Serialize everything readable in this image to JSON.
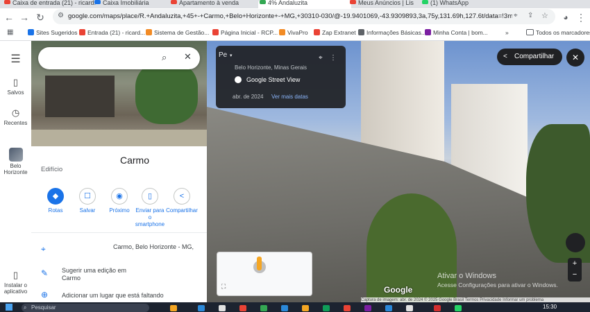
{
  "browser": {
    "tabs": [
      {
        "label": "Caixa de entrada (21) - ricard...",
        "color": "#ea4335"
      },
      {
        "label": "Caixa Imobiliária",
        "color": "#1a73e8"
      },
      {
        "label": "Apartamento à venda",
        "color": "#ea4335"
      },
      {
        "label": "4% Andaluzita",
        "color": "#34a853"
      },
      {
        "label": "Meus Anúncios | Lis",
        "color": "#ea4335"
      },
      {
        "label": "(1) WhatsApp",
        "color": "#25d366"
      }
    ],
    "url": "google.com/maps/place/R.+Andaluzita,+45+-+Carmo,+Belo+Horizonte+-+MG,+30310-030/@-19.9401069,-43.9309893,3a,75y,131.69h,127.6t/data=!3m7!1e1!3m...",
    "bookmarks": [
      {
        "label": "Sites Sugeridos",
        "color": "#1a73e8"
      },
      {
        "label": "Entrada (21) - ricard...",
        "color": "#ea4335"
      },
      {
        "label": "Sistema de Gestão...",
        "color": "#f28b25"
      },
      {
        "label": "Página Inicial - RCP...",
        "color": "#ea4335"
      },
      {
        "label": "VivaPro",
        "color": "#f28b25"
      },
      {
        "label": "Zap Extranet",
        "color": "#ea4335"
      },
      {
        "label": "Informações Básicas...",
        "color": "#5f6368"
      },
      {
        "label": "Minha Conta | bom...",
        "color": "#7b1fa2"
      },
      {
        "label": "Todos os marcadores",
        "color": "#5f6368"
      }
    ],
    "more_bookmarks": "»"
  },
  "rail": {
    "menu_icon": "menu-icon",
    "items": [
      {
        "label": "Salvos",
        "icon": "bookmark-icon"
      },
      {
        "label": "Recentes",
        "icon": "history-icon"
      },
      {
        "label": "Belo Horizonte",
        "icon": "city-thumbnail"
      },
      {
        "label": "Instalar o aplicativo",
        "icon": "phone-icon"
      }
    ]
  },
  "place": {
    "title": "Carmo",
    "type": "Edifício",
    "actions": [
      {
        "label": "Rotas",
        "glyph": "◆"
      },
      {
        "label": "Salvar",
        "glyph": "☐"
      },
      {
        "label": "Próximo",
        "glyph": "◉"
      },
      {
        "label": "Enviar para o smartphone",
        "glyph": "▯"
      },
      {
        "label": "Compartilhar",
        "glyph": "<"
      }
    ],
    "address": "Carmo, Belo Horizonte - MG,",
    "suggest_edit": "Sugerir uma edição em",
    "suggest_edit_2": "Carmo",
    "add_place": "Adicionar um lugar que está faltando"
  },
  "streetview": {
    "card_title": "Pe",
    "card_location": "Belo Horizonte, Minas Gerais",
    "card_brand": "Google Street View",
    "card_date": "abr. de 2024",
    "card_more": "Ver mais datas",
    "share_label": "Compartilhar",
    "watermark_title": "Ativar o Windows",
    "watermark_sub": "Acesse Configurações para ativar o Windows.",
    "logo": "Google",
    "footer": "Captura de imagem: abr. de 2024   © 2025 Google   Brasil   Termos   Privacidade   Informar um problema"
  },
  "taskbar": {
    "search_placeholder": "Pesquisar",
    "time": "15:30"
  }
}
